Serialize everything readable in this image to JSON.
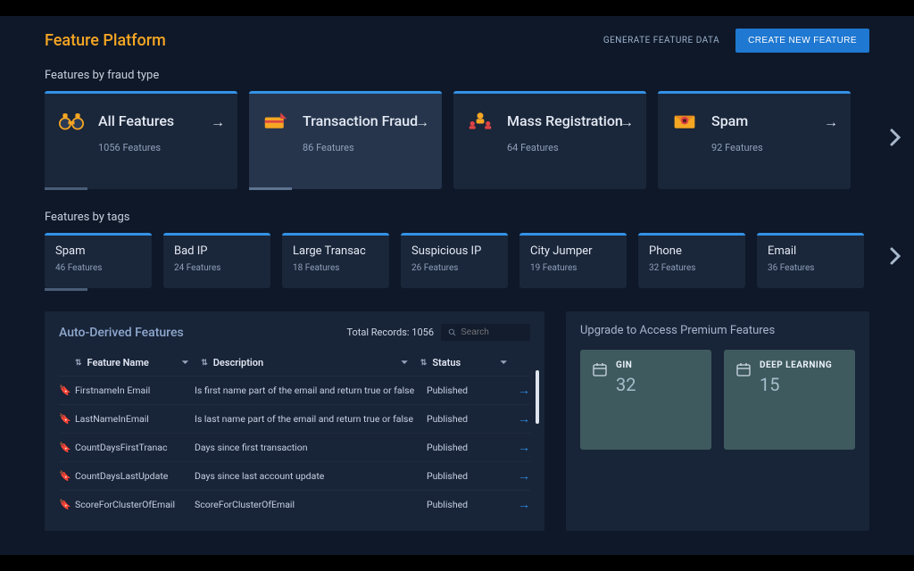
{
  "header": {
    "brand": "Feature Platform",
    "generate_link": "GENERATE FEATURE DATA",
    "create_btn": "CREATE NEW FEATURE"
  },
  "fraud_section": {
    "title": "Features by fraud type",
    "cards": [
      {
        "title": "All Features",
        "count": "1056 Features"
      },
      {
        "title": "Transaction Fraud",
        "count": "86 Features"
      },
      {
        "title": "Mass Registration",
        "count": "64 Features"
      },
      {
        "title": "Spam",
        "count": "92 Features"
      }
    ]
  },
  "tags_section": {
    "title": "Features by tags",
    "tags": [
      {
        "title": "Spam",
        "count": "46 Features"
      },
      {
        "title": "Bad IP",
        "count": "24 Features"
      },
      {
        "title": "Large Transac",
        "count": "18 Features"
      },
      {
        "title": "Suspicious IP",
        "count": "26 Features"
      },
      {
        "title": "City Jumper",
        "count": "19 Features"
      },
      {
        "title": "Phone",
        "count": "32 Features"
      },
      {
        "title": "Email",
        "count": "36 Features"
      }
    ]
  },
  "table": {
    "title": "Auto-Derived Features",
    "total_label": "Total Records: 1056",
    "search_placeholder": "Search",
    "cols": {
      "name": "Feature Name",
      "desc": "Description",
      "status": "Status"
    },
    "rows": [
      {
        "name": "FirstnameIn Email",
        "desc": "Is first name part of the email and return true or false",
        "status": "Published"
      },
      {
        "name": "LastNameInEmail",
        "desc": "Is last name part of the email and return true or false",
        "status": "Published"
      },
      {
        "name": "CountDaysFirstTranac",
        "desc": "Days since first transaction",
        "status": "Published"
      },
      {
        "name": "CountDaysLastUpdate",
        "desc": "Days since last account update",
        "status": "Published"
      },
      {
        "name": "ScoreForClusterOfEmail",
        "desc": "ScoreForClusterOfEmail",
        "status": "Published"
      }
    ]
  },
  "premium": {
    "title": "Upgrade to Access Premium Features",
    "cards": [
      {
        "name": "GIN",
        "num": "32"
      },
      {
        "name": "DEEP LEARNING",
        "num": "15"
      }
    ]
  }
}
